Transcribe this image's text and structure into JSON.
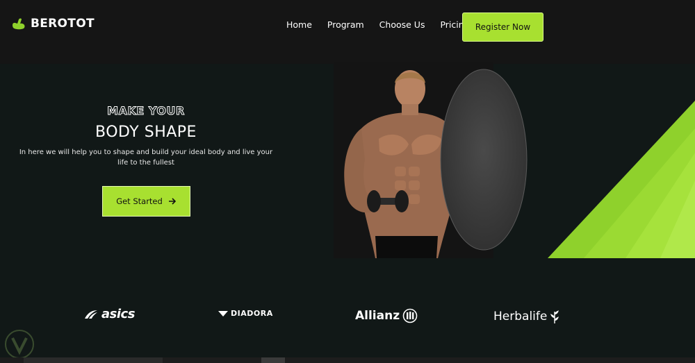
{
  "header": {
    "logo_text": "BEROTOT",
    "nav": [
      "Home",
      "Program",
      "Choose Us",
      "Pricing"
    ],
    "register_label": "Register Now"
  },
  "hero": {
    "subtitle": "MAKE YOUR",
    "title": "BODY SHAPE",
    "description": "In here we will help you to shape and build your ideal body and live your life to the fullest",
    "cta_label": "Get Started"
  },
  "brands": {
    "asics": "asics",
    "diadora": "DIADORA",
    "allianz": "Allianz",
    "herbalife": "Herbalife"
  },
  "colors": {
    "accent": "#a8e030",
    "background": "#111817",
    "header": "#151515"
  }
}
